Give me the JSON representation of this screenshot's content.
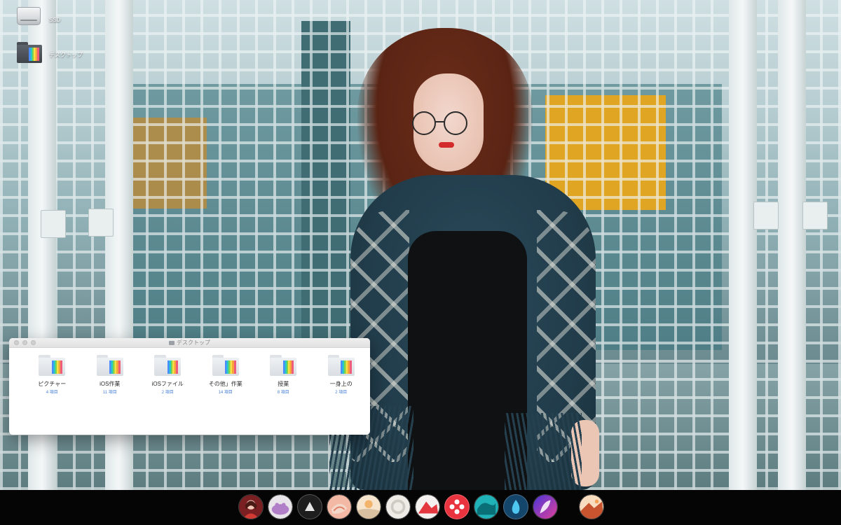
{
  "desktop": {
    "icons": [
      {
        "label": "SSD",
        "icon": "ssd-drive-icon"
      },
      {
        "label": "デスクトップ",
        "icon": "folder-icon"
      }
    ]
  },
  "finder": {
    "title": "デスクトップ",
    "items": [
      {
        "name": "ピクチャー",
        "count": "4 項目"
      },
      {
        "name": "iOS作業",
        "count": "11 項目"
      },
      {
        "name": "iOSファイル",
        "count": "2 項目"
      },
      {
        "name": "その他」作業",
        "count": "14 項目"
      },
      {
        "name": "授業",
        "count": "8 項目"
      },
      {
        "name": "一身上の",
        "count": "2 項目"
      }
    ]
  },
  "dock": {
    "apps": [
      {
        "icon": "portrait-app-icon",
        "color": "#b3302f"
      },
      {
        "icon": "hippo-app-icon",
        "color": "#c9a0d8"
      },
      {
        "icon": "triangle-app-icon",
        "color": "#2a2a2a"
      },
      {
        "icon": "peach-app-icon",
        "color": "#f2a08a"
      },
      {
        "icon": "landscape-app-icon",
        "color": "#f0d8b4"
      },
      {
        "icon": "ring-app-icon",
        "color": "#e8e6e2"
      },
      {
        "icon": "mountain-app-icon",
        "color": "#e8303a"
      },
      {
        "icon": "compass-app-icon",
        "color": "#e9343f"
      },
      {
        "icon": "wave-app-icon",
        "color": "#1fb3b8"
      },
      {
        "icon": "flame-app-icon",
        "color": "#1a6fa8"
      },
      {
        "icon": "feather-app-icon",
        "color": "#8b3fd6"
      },
      {
        "icon": "desert-app-icon",
        "color": "#f0c9a0"
      }
    ]
  }
}
